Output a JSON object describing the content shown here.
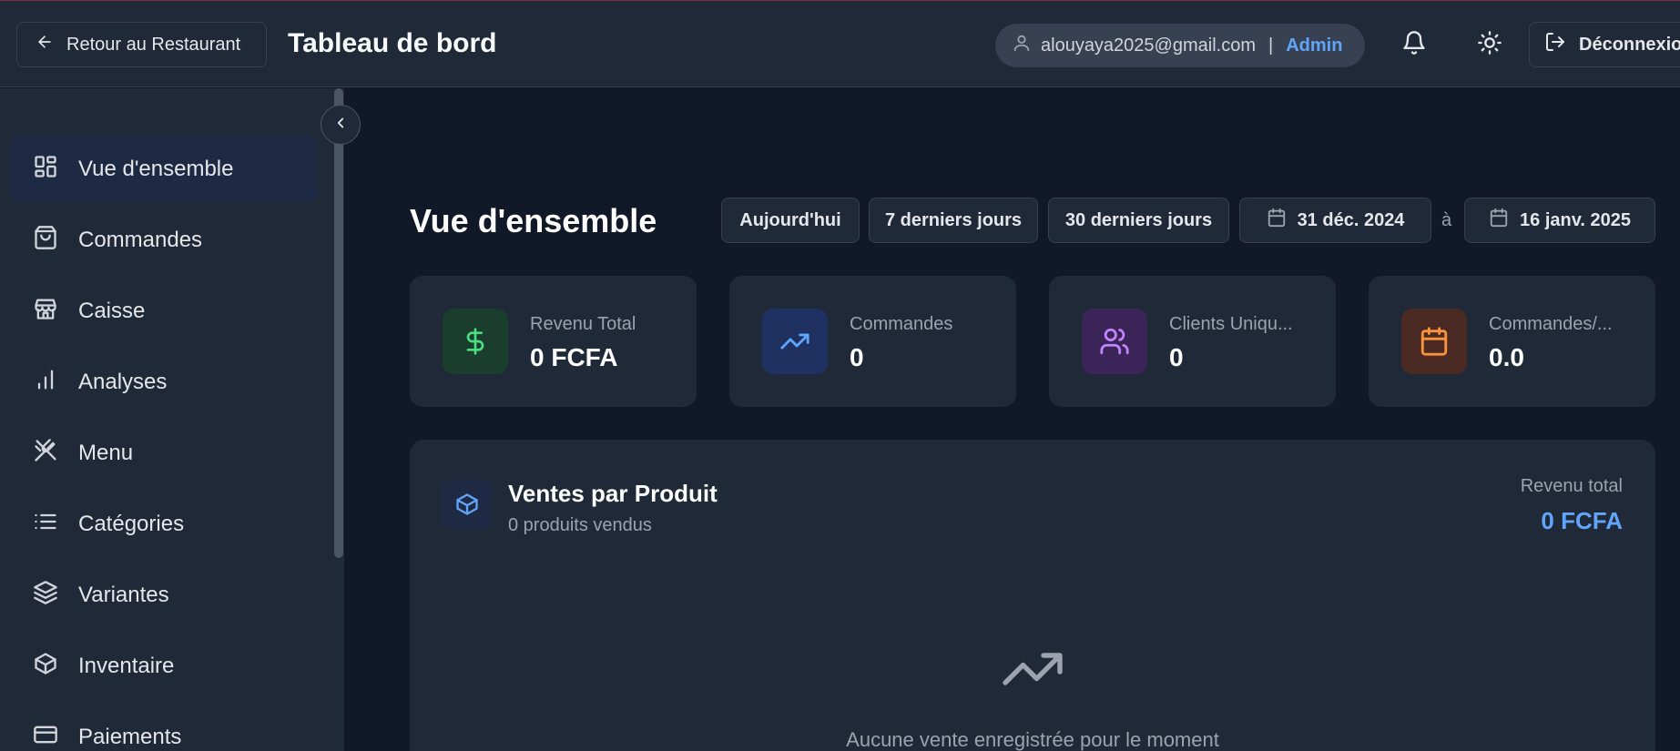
{
  "header": {
    "back_label": "Retour au Restaurant",
    "title": "Tableau de bord",
    "user_email": "alouyaya2025@gmail.com",
    "separator": "|",
    "user_role": "Admin",
    "logout_label": "Déconnexion"
  },
  "sidebar": {
    "items": [
      {
        "label": "Vue d'ensemble",
        "icon": "dashboard-icon",
        "active": true
      },
      {
        "label": "Commandes",
        "icon": "shopping-bag-icon"
      },
      {
        "label": "Caisse",
        "icon": "store-icon"
      },
      {
        "label": "Analyses",
        "icon": "bar-chart-icon"
      },
      {
        "label": "Menu",
        "icon": "utensils-icon"
      },
      {
        "label": "Catégories",
        "icon": "list-icon"
      },
      {
        "label": "Variantes",
        "icon": "layers-icon"
      },
      {
        "label": "Inventaire",
        "icon": "package-icon"
      },
      {
        "label": "Paiements",
        "icon": "credit-card-icon"
      }
    ]
  },
  "main": {
    "title": "Vue d'ensemble",
    "filters": {
      "today": "Aujourd'hui",
      "last7": "7 derniers jours",
      "last30": "30 derniers jours",
      "start_date": "31 déc. 2024",
      "to": "à",
      "end_date": "16 janv. 2025"
    },
    "stats": [
      {
        "label": "Revenu Total",
        "value": "0 FCFA",
        "icon": "dollar-icon",
        "color": "#4ade80"
      },
      {
        "label": "Commandes",
        "value": "0",
        "icon": "trending-up-icon",
        "color": "#60a5fa"
      },
      {
        "label": "Clients Uniqu...",
        "value": "0",
        "icon": "users-icon",
        "color": "#c084fc"
      },
      {
        "label": "Commandes/...",
        "value": "0.0",
        "icon": "calendar-icon",
        "color": "#fb923c"
      }
    ],
    "sales": {
      "title": "Ventes par Produit",
      "subtitle": "0 produits vendus",
      "revenue_label": "Revenu total",
      "revenue_value": "0 FCFA",
      "empty_text": "Aucune vente enregistrée pour le moment"
    }
  },
  "colors": {
    "background": "#111827",
    "panel": "#1f2937",
    "accent": "#60a5fa"
  }
}
